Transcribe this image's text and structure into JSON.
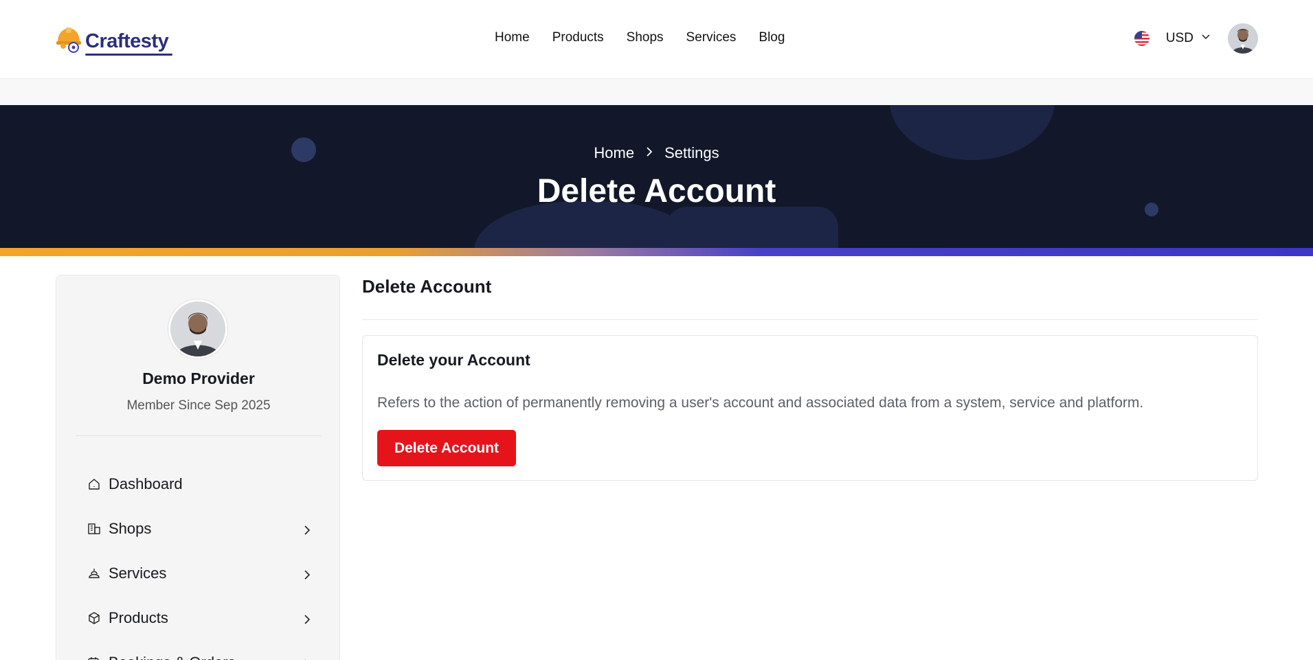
{
  "brand": {
    "name": "Craftesty",
    "accent": "#2a2f7a",
    "logo_color": "#f2a52a"
  },
  "nav": {
    "items": [
      {
        "label": "Home"
      },
      {
        "label": "Products"
      },
      {
        "label": "Shops"
      },
      {
        "label": "Services"
      },
      {
        "label": "Blog"
      }
    ]
  },
  "header": {
    "flag_icon": "us-flag-icon",
    "currency": "USD",
    "currency_icon": "chevron-down-icon",
    "avatar_icon": "user-avatar"
  },
  "banner": {
    "breadcrumb": [
      "Home",
      "Settings"
    ],
    "separator_icon": "chevron-right-icon",
    "title": "Delete Account",
    "background": "#121829"
  },
  "sidebar": {
    "name": "Demo Provider",
    "member_since": "Member Since Sep 2025",
    "items": [
      {
        "label": "Dashboard",
        "icon": "home-icon",
        "has_submenu": false
      },
      {
        "label": "Shops",
        "icon": "shop-icon",
        "has_submenu": true
      },
      {
        "label": "Services",
        "icon": "services-icon",
        "has_submenu": true
      },
      {
        "label": "Products",
        "icon": "box-icon",
        "has_submenu": true
      },
      {
        "label": "Bookings & Orders",
        "icon": "calendar-icon",
        "has_submenu": true
      }
    ]
  },
  "main": {
    "title": "Delete Account",
    "card": {
      "title": "Delete your Account",
      "description": "Refers to the action of permanently removing a user's account and associated data from a system, service and platform.",
      "button_label": "Delete Account",
      "button_color": "#e5141b"
    }
  }
}
